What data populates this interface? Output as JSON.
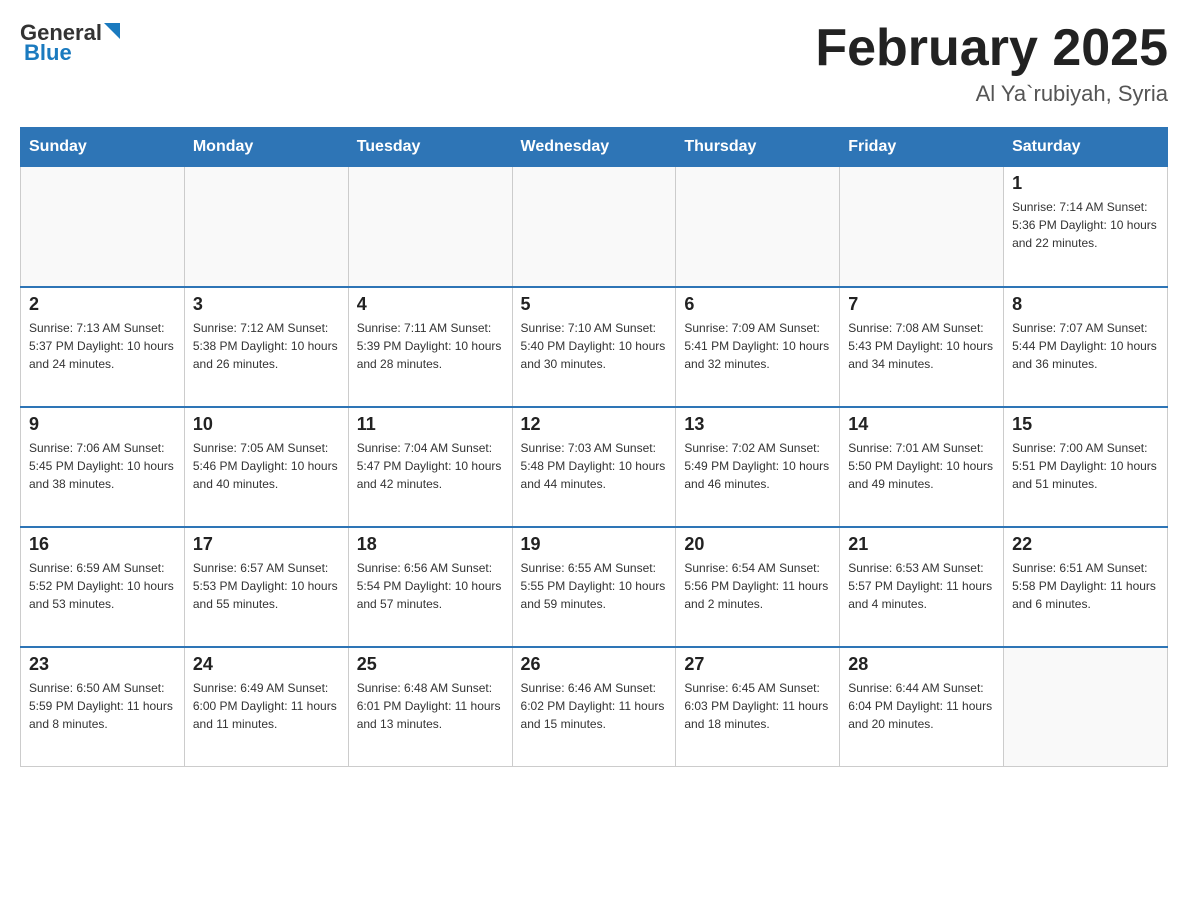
{
  "header": {
    "logo_general": "General",
    "logo_blue": "Blue",
    "title": "February 2025",
    "subtitle": "Al Ya`rubiyah, Syria"
  },
  "days_of_week": [
    "Sunday",
    "Monday",
    "Tuesday",
    "Wednesday",
    "Thursday",
    "Friday",
    "Saturday"
  ],
  "weeks": [
    [
      {
        "day": "",
        "info": ""
      },
      {
        "day": "",
        "info": ""
      },
      {
        "day": "",
        "info": ""
      },
      {
        "day": "",
        "info": ""
      },
      {
        "day": "",
        "info": ""
      },
      {
        "day": "",
        "info": ""
      },
      {
        "day": "1",
        "info": "Sunrise: 7:14 AM\nSunset: 5:36 PM\nDaylight: 10 hours and 22 minutes."
      }
    ],
    [
      {
        "day": "2",
        "info": "Sunrise: 7:13 AM\nSunset: 5:37 PM\nDaylight: 10 hours and 24 minutes."
      },
      {
        "day": "3",
        "info": "Sunrise: 7:12 AM\nSunset: 5:38 PM\nDaylight: 10 hours and 26 minutes."
      },
      {
        "day": "4",
        "info": "Sunrise: 7:11 AM\nSunset: 5:39 PM\nDaylight: 10 hours and 28 minutes."
      },
      {
        "day": "5",
        "info": "Sunrise: 7:10 AM\nSunset: 5:40 PM\nDaylight: 10 hours and 30 minutes."
      },
      {
        "day": "6",
        "info": "Sunrise: 7:09 AM\nSunset: 5:41 PM\nDaylight: 10 hours and 32 minutes."
      },
      {
        "day": "7",
        "info": "Sunrise: 7:08 AM\nSunset: 5:43 PM\nDaylight: 10 hours and 34 minutes."
      },
      {
        "day": "8",
        "info": "Sunrise: 7:07 AM\nSunset: 5:44 PM\nDaylight: 10 hours and 36 minutes."
      }
    ],
    [
      {
        "day": "9",
        "info": "Sunrise: 7:06 AM\nSunset: 5:45 PM\nDaylight: 10 hours and 38 minutes."
      },
      {
        "day": "10",
        "info": "Sunrise: 7:05 AM\nSunset: 5:46 PM\nDaylight: 10 hours and 40 minutes."
      },
      {
        "day": "11",
        "info": "Sunrise: 7:04 AM\nSunset: 5:47 PM\nDaylight: 10 hours and 42 minutes."
      },
      {
        "day": "12",
        "info": "Sunrise: 7:03 AM\nSunset: 5:48 PM\nDaylight: 10 hours and 44 minutes."
      },
      {
        "day": "13",
        "info": "Sunrise: 7:02 AM\nSunset: 5:49 PM\nDaylight: 10 hours and 46 minutes."
      },
      {
        "day": "14",
        "info": "Sunrise: 7:01 AM\nSunset: 5:50 PM\nDaylight: 10 hours and 49 minutes."
      },
      {
        "day": "15",
        "info": "Sunrise: 7:00 AM\nSunset: 5:51 PM\nDaylight: 10 hours and 51 minutes."
      }
    ],
    [
      {
        "day": "16",
        "info": "Sunrise: 6:59 AM\nSunset: 5:52 PM\nDaylight: 10 hours and 53 minutes."
      },
      {
        "day": "17",
        "info": "Sunrise: 6:57 AM\nSunset: 5:53 PM\nDaylight: 10 hours and 55 minutes."
      },
      {
        "day": "18",
        "info": "Sunrise: 6:56 AM\nSunset: 5:54 PM\nDaylight: 10 hours and 57 minutes."
      },
      {
        "day": "19",
        "info": "Sunrise: 6:55 AM\nSunset: 5:55 PM\nDaylight: 10 hours and 59 minutes."
      },
      {
        "day": "20",
        "info": "Sunrise: 6:54 AM\nSunset: 5:56 PM\nDaylight: 11 hours and 2 minutes."
      },
      {
        "day": "21",
        "info": "Sunrise: 6:53 AM\nSunset: 5:57 PM\nDaylight: 11 hours and 4 minutes."
      },
      {
        "day": "22",
        "info": "Sunrise: 6:51 AM\nSunset: 5:58 PM\nDaylight: 11 hours and 6 minutes."
      }
    ],
    [
      {
        "day": "23",
        "info": "Sunrise: 6:50 AM\nSunset: 5:59 PM\nDaylight: 11 hours and 8 minutes."
      },
      {
        "day": "24",
        "info": "Sunrise: 6:49 AM\nSunset: 6:00 PM\nDaylight: 11 hours and 11 minutes."
      },
      {
        "day": "25",
        "info": "Sunrise: 6:48 AM\nSunset: 6:01 PM\nDaylight: 11 hours and 13 minutes."
      },
      {
        "day": "26",
        "info": "Sunrise: 6:46 AM\nSunset: 6:02 PM\nDaylight: 11 hours and 15 minutes."
      },
      {
        "day": "27",
        "info": "Sunrise: 6:45 AM\nSunset: 6:03 PM\nDaylight: 11 hours and 18 minutes."
      },
      {
        "day": "28",
        "info": "Sunrise: 6:44 AM\nSunset: 6:04 PM\nDaylight: 11 hours and 20 minutes."
      },
      {
        "day": "",
        "info": ""
      }
    ]
  ]
}
